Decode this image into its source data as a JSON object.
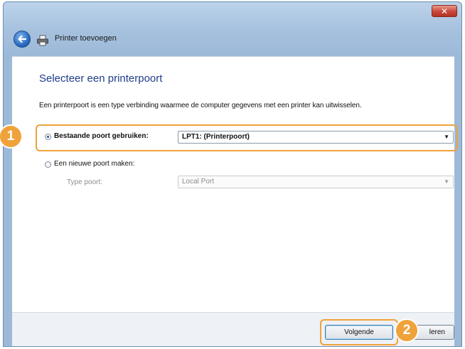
{
  "window": {
    "title": "Printer toevoegen",
    "close_glyph": "✕"
  },
  "page": {
    "heading": "Selecteer een printerpoort",
    "description": "Een printerpoort is een type verbinding waarmee de computer gegevens met een printer kan uitwisselen."
  },
  "options": {
    "existing_port_label": "Bestaande poort gebruiken:",
    "existing_port_value": "LPT1: (Printerpoort)",
    "existing_port_selected": true,
    "new_port_label": "Een nieuwe poort maken:",
    "new_port_selected": false,
    "port_type_label": "Type poort:",
    "port_type_value": "Local Port"
  },
  "footer": {
    "next_label": "Volgende",
    "cancel_label_visible": "leren"
  },
  "annotations": {
    "step1": "1",
    "step2": "2"
  },
  "icons": {
    "back": "back-arrow-icon",
    "printer": "printer-icon",
    "close": "close-icon",
    "dropdown": "chevron-down-icon"
  },
  "colors": {
    "highlight": "#f0a23a",
    "heading": "#1e3d8a",
    "titlebar": "#a6c1de"
  }
}
